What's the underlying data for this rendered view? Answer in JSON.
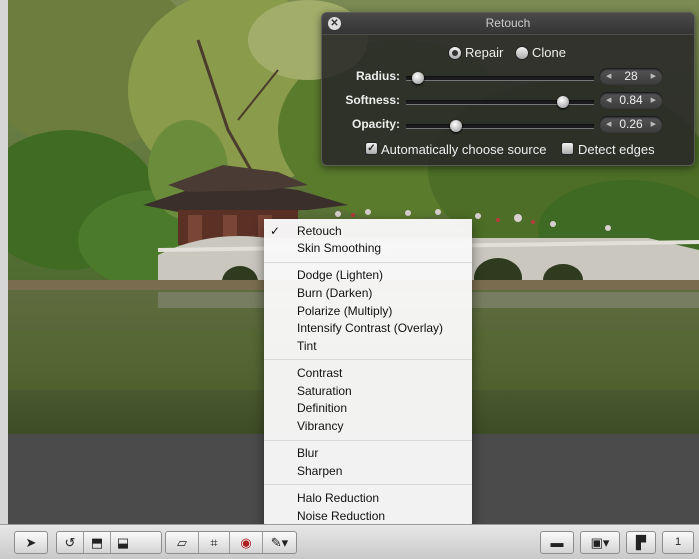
{
  "hud": {
    "title": "Retouch",
    "close_icon": "close-icon",
    "mode_options": [
      {
        "label": "Repair",
        "selected": true
      },
      {
        "label": "Clone",
        "selected": false
      }
    ],
    "sliders": [
      {
        "label": "Radius:",
        "value": "28",
        "level": 0.07
      },
      {
        "label": "Softness:",
        "value": "0.84",
        "level": 0.84
      },
      {
        "label": "Opacity:",
        "value": "0.26",
        "level": 0.26
      }
    ],
    "checkboxes": [
      {
        "label": "Automatically choose source",
        "checked": true
      },
      {
        "label": "Detect edges",
        "checked": false
      }
    ]
  },
  "menu": {
    "groups": [
      [
        {
          "label": "Retouch",
          "checked": true
        },
        {
          "label": "Skin Smoothing",
          "checked": false
        }
      ],
      [
        {
          "label": "Dodge (Lighten)"
        },
        {
          "label": "Burn (Darken)"
        },
        {
          "label": "Polarize (Multiply)"
        },
        {
          "label": "Intensify Contrast (Overlay)"
        },
        {
          "label": "Tint"
        }
      ],
      [
        {
          "label": "Contrast"
        },
        {
          "label": "Saturation"
        },
        {
          "label": "Definition"
        },
        {
          "label": "Vibrancy"
        }
      ],
      [
        {
          "label": "Blur"
        },
        {
          "label": "Sharpen"
        }
      ],
      [
        {
          "label": "Halo Reduction"
        },
        {
          "label": "Noise Reduction"
        }
      ]
    ]
  },
  "toolbar": {
    "left_tools": [
      "pointer-icon",
      "straighten-icon",
      "lift-stamp-icon",
      "stamp-icon",
      "crop-rotate-icon",
      "crop-icon",
      "red-eye-icon",
      "brush-menu-icon"
    ],
    "right_tools": [
      "viewer-icon",
      "layout-icon",
      "split-icon",
      "one-up-icon"
    ],
    "right_label": "1"
  },
  "colors": {
    "hud_bg": "#282828",
    "menu_bg": "#f8f8f8",
    "toolbar_bg": "#d9d9d9"
  }
}
